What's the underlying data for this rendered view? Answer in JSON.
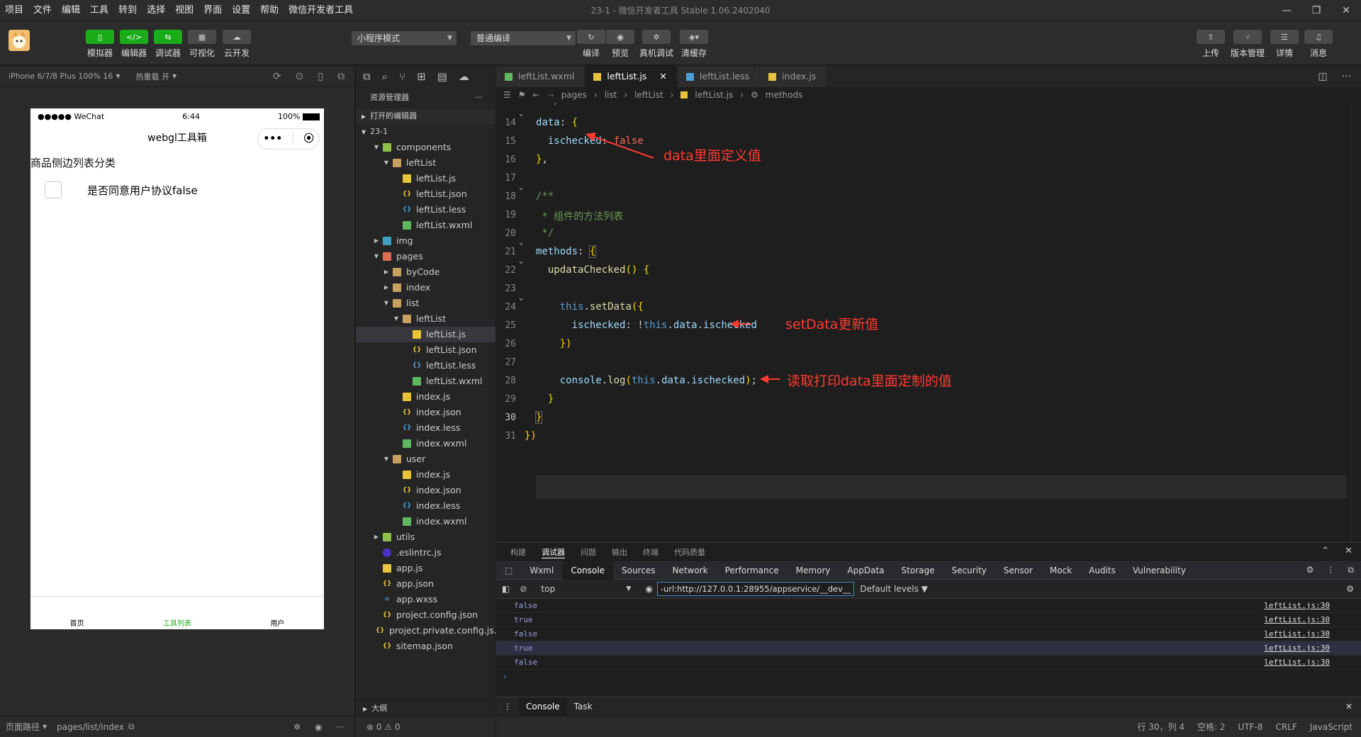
{
  "menu": [
    "项目",
    "文件",
    "编辑",
    "工具",
    "转到",
    "选择",
    "视图",
    "界面",
    "设置",
    "帮助",
    "微信开发者工具"
  ],
  "window_title": "23-1 - 微信开发者工具 Stable 1.06.2402040",
  "toolbar": {
    "simulator": "模拟器",
    "editor": "编辑器",
    "debugger": "调试器",
    "visual": "可视化",
    "cloud": "云开发",
    "mode_select": "小程序模式",
    "compile_select": "普通编译",
    "compile": "编译",
    "preview": "预览",
    "real_debug": "真机调试",
    "clear_cache": "清缓存",
    "upload": "上传",
    "version": "版本管理",
    "details": "详情",
    "messages": "消息"
  },
  "device": {
    "model": "iPhone 6/7/8 Plus 100% 16",
    "hot_reload": "热重载 开"
  },
  "phone": {
    "carrier": "●●●●● WeChat",
    "time": "6:44",
    "battery": "100%",
    "nav_title": "webgl工具箱",
    "capsule_dots": "•••",
    "page_title": "商品侧边列表分类",
    "checkbox_label": "是否同意用户协议false",
    "tabs": [
      "首页",
      "工具列表",
      "用户"
    ],
    "active_tab_color": "#1aad19"
  },
  "sim_footer": {
    "path_label": "页面路径",
    "path": "pages/list/index"
  },
  "explorer": {
    "title": "资源管理器",
    "more": "···",
    "open_editors": "打开的编辑器",
    "project": "23-1",
    "outline": "大纲",
    "tree": [
      {
        "name": "components",
        "type": "folder-c",
        "depth": 1,
        "open": true
      },
      {
        "name": "leftList",
        "type": "folder",
        "depth": 2,
        "open": true
      },
      {
        "name": "leftList.js",
        "type": "js",
        "depth": 3
      },
      {
        "name": "leftList.json",
        "type": "json",
        "depth": 3
      },
      {
        "name": "leftList.less",
        "type": "less",
        "depth": 3
      },
      {
        "name": "leftList.wxml",
        "type": "wxml",
        "depth": 3
      },
      {
        "name": "img",
        "type": "folder-img",
        "depth": 1,
        "open": false
      },
      {
        "name": "pages",
        "type": "folder-p",
        "depth": 1,
        "open": true
      },
      {
        "name": "byCode",
        "type": "folder",
        "depth": 2,
        "open": false
      },
      {
        "name": "index",
        "type": "folder",
        "depth": 2,
        "open": false
      },
      {
        "name": "list",
        "type": "folder",
        "depth": 2,
        "open": true
      },
      {
        "name": "leftList",
        "type": "folder",
        "depth": 3,
        "open": true
      },
      {
        "name": "leftList.js",
        "type": "js",
        "depth": 4,
        "selected": true
      },
      {
        "name": "leftList.json",
        "type": "json",
        "depth": 4
      },
      {
        "name": "leftList.less",
        "type": "less",
        "depth": 4
      },
      {
        "name": "leftList.wxml",
        "type": "wxml",
        "depth": 4
      },
      {
        "name": "index.js",
        "type": "js",
        "depth": 3
      },
      {
        "name": "index.json",
        "type": "json",
        "depth": 3
      },
      {
        "name": "index.less",
        "type": "less",
        "depth": 3
      },
      {
        "name": "index.wxml",
        "type": "wxml",
        "depth": 3
      },
      {
        "name": "user",
        "type": "folder",
        "depth": 2,
        "open": true
      },
      {
        "name": "index.js",
        "type": "js",
        "depth": 3
      },
      {
        "name": "index.json",
        "type": "json",
        "depth": 3
      },
      {
        "name": "index.less",
        "type": "less",
        "depth": 3
      },
      {
        "name": "index.wxml",
        "type": "wxml",
        "depth": 3
      },
      {
        "name": "utils",
        "type": "folder-c",
        "depth": 1,
        "open": false
      },
      {
        "name": ".eslintrc.js",
        "type": "eslint",
        "depth": 1
      },
      {
        "name": "app.js",
        "type": "js",
        "depth": 1
      },
      {
        "name": "app.json",
        "type": "json",
        "depth": 1
      },
      {
        "name": "app.wxss",
        "type": "wxss",
        "depth": 1
      },
      {
        "name": "project.config.json",
        "type": "json",
        "depth": 1
      },
      {
        "name": "project.private.config.js...",
        "type": "json",
        "depth": 1
      },
      {
        "name": "sitemap.json",
        "type": "json",
        "depth": 1
      }
    ],
    "problems": "⊗ 0 ⚠ 0"
  },
  "tabs": [
    {
      "label": "leftList.wxml",
      "type": "wxml",
      "active": false
    },
    {
      "label": "leftList.js",
      "type": "js",
      "active": true
    },
    {
      "label": "leftList.less",
      "type": "less",
      "active": false
    },
    {
      "label": "index.js",
      "type": "js",
      "active": false
    }
  ],
  "breadcrumb": [
    "pages",
    "list",
    "leftList",
    "leftList.js",
    "methods"
  ],
  "code": {
    "lines": [
      {
        "n": "14",
        "fold": true
      },
      {
        "n": "15"
      },
      {
        "n": "16"
      },
      {
        "n": "17"
      },
      {
        "n": "18",
        "fold": true
      },
      {
        "n": "19"
      },
      {
        "n": "20"
      },
      {
        "n": "21",
        "fold": true
      },
      {
        "n": "22",
        "fold": true
      },
      {
        "n": "23"
      },
      {
        "n": "24",
        "fold": true
      },
      {
        "n": "25"
      },
      {
        "n": "26"
      },
      {
        "n": "27"
      },
      {
        "n": "28"
      },
      {
        "n": "29"
      },
      {
        "n": "30",
        "current": true
      },
      {
        "n": "31"
      }
    ],
    "annotations": {
      "data_def": "data里面定义值",
      "set_data": "setData更新值",
      "read_log": "读取打印data里面定制的值"
    }
  },
  "panel": {
    "tabs": [
      "构建",
      "调试器",
      "问题",
      "输出",
      "终端",
      "代码质量"
    ],
    "active_tab": "调试器",
    "devtools_tabs": [
      "Wxml",
      "Console",
      "Sources",
      "Network",
      "Performance",
      "Memory",
      "AppData",
      "Storage",
      "Security",
      "Sensor",
      "Mock",
      "Audits",
      "Vulnerability"
    ],
    "active_devtools_tab": "Console",
    "context": "top",
    "filter": "-url:http://127.0.0.1:28955/appservice/__dev__",
    "levels": "Default levels ▼",
    "logs": [
      {
        "value": "false",
        "source": "leftList.js:30"
      },
      {
        "value": "true",
        "source": "leftList.js:30"
      },
      {
        "value": "false",
        "source": "leftList.js:30"
      },
      {
        "value": "true",
        "source": "leftList.js:30"
      },
      {
        "value": "false",
        "source": "leftList.js:30"
      }
    ],
    "prompt": "›",
    "drawer": [
      "Console",
      "Task"
    ]
  },
  "status": {
    "position": "行 30，列 4",
    "spaces": "空格: 2",
    "encoding": "UTF-8",
    "eol": "CRLF",
    "language": "JavaScript"
  }
}
